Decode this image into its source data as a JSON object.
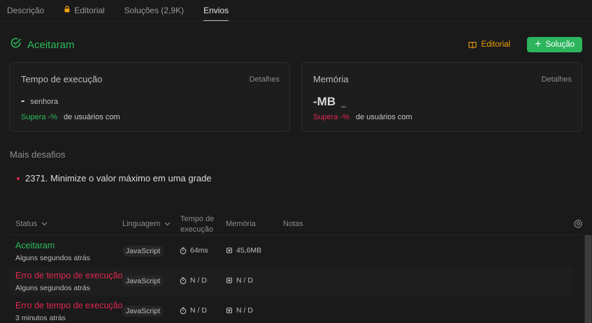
{
  "tabs": [
    {
      "label": "Descrição",
      "active": false,
      "locked": false
    },
    {
      "label": "Editorial",
      "active": false,
      "locked": true
    },
    {
      "label": "Soluções (2,9K)",
      "active": false,
      "locked": false
    },
    {
      "label": "Envios",
      "active": true,
      "locked": false
    }
  ],
  "result": {
    "status": "Aceitaram",
    "editorial_label": "Editorial",
    "solution_label": "Solução"
  },
  "runtime_card": {
    "title": "Tempo de execução",
    "details": "Detalhes",
    "value": "-",
    "unit": "senhora",
    "beats_label": "Supera -%",
    "beats_rest": "de usuários com"
  },
  "memory_card": {
    "title": "Memória",
    "details": "Detalhes",
    "value": "-MB",
    "unit": "_",
    "beats_label": "Supera -%",
    "beats_rest": "de usuários com"
  },
  "more_challenges": {
    "title": "Mais desafios",
    "items": [
      {
        "label": "2371. Minimize o valor máximo em uma grade"
      }
    ]
  },
  "table": {
    "headers": {
      "status": "Status",
      "language": "Linguagem",
      "runtime_line1": "Tempo de",
      "runtime_line2": "execução",
      "memory": "Memória",
      "notes": "Notas"
    },
    "rows": [
      {
        "status": "Aceitaram",
        "status_kind": "accepted",
        "time_ago": "Alguns segundos atrás",
        "language": "JavaScript",
        "runtime": "64ms",
        "memory": "45,6MB"
      },
      {
        "status": "Erro de tempo de execução",
        "status_kind": "error",
        "time_ago": "Alguns segundos atrás",
        "language": "JavaScript",
        "runtime": "N / D",
        "memory": "N / D"
      },
      {
        "status": "Erro de tempo de execução",
        "status_kind": "error",
        "time_ago": "3 minutos atrás",
        "language": "JavaScript",
        "runtime": "N / D",
        "memory": "N / D"
      }
    ]
  },
  "colors": {
    "background": "#1a1a1a",
    "accepted": "#2cbb5d",
    "error": "#e0284f",
    "editorial": "#f0a30a",
    "button": "#2cb55d"
  },
  "icons": [
    "lock-icon",
    "check-circle-icon",
    "book-icon",
    "plus-icon",
    "chevron-down-icon",
    "gear-icon",
    "clock-icon",
    "chip-icon"
  ]
}
